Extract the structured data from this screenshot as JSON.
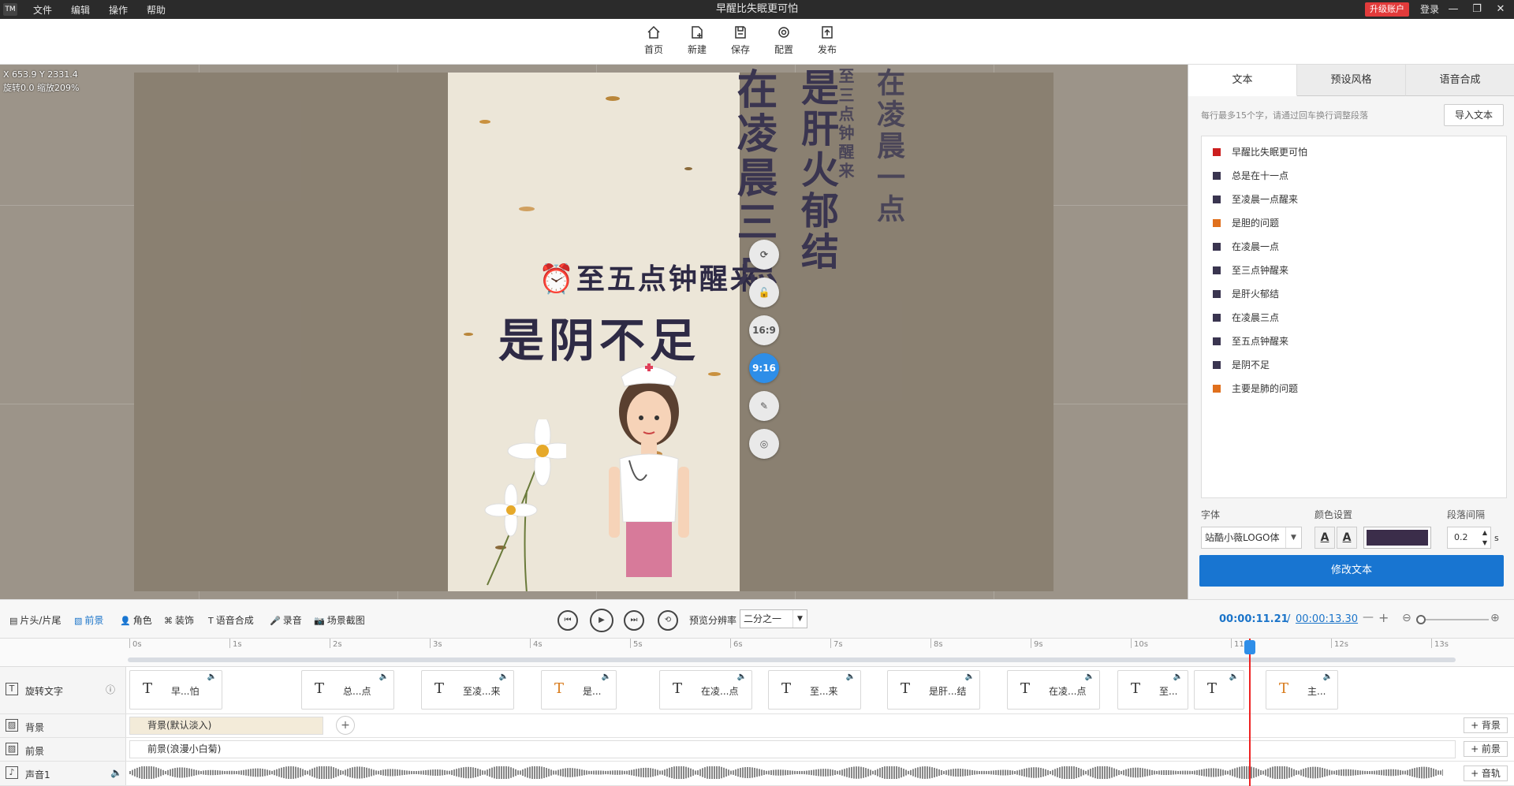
{
  "window": {
    "logo": "TM",
    "title": "早醒比失眠更可怕",
    "menu": [
      "文件",
      "编辑",
      "操作",
      "帮助"
    ],
    "upgrade_label": "升级账户",
    "login_label": "登录",
    "controls": [
      "—",
      "❐",
      "✕"
    ]
  },
  "toolbar": {
    "home": "首页",
    "new": "新建",
    "save": "保存",
    "config": "配置",
    "publish": "发布"
  },
  "canvas": {
    "coord_line": "X 653.9 Y 2331.4",
    "transform_line": "旋转0.0 缩放209%",
    "preview_line1": "⏰至五点钟醒来",
    "preview_line2": "是阴不足",
    "vertical_texts": [
      "在凌晨一点",
      "至三点钟醒来",
      "是肝火郁结",
      "在凌晨三点"
    ],
    "side_buttons": {
      "ratio_16_9": "16:9",
      "ratio_9_16": "9:16"
    }
  },
  "right_panel": {
    "tabs": [
      "文本",
      "预设风格",
      "语音合成"
    ],
    "hint": "每行最多15个字，请通过回车换行调整段落",
    "import_label": "导入文本",
    "lines": [
      {
        "text": "早醒比失眠更可怕",
        "color": "#cc1f1f"
      },
      {
        "text": "总是在十一点",
        "color": "#3a3550"
      },
      {
        "text": "至凌晨一点醒来",
        "color": "#3a3550"
      },
      {
        "text": "是胆的问题",
        "color": "#e0701d"
      },
      {
        "text": "在凌晨一点",
        "color": "#3a3550"
      },
      {
        "text": "至三点钟醒来",
        "color": "#3a3550"
      },
      {
        "text": "是肝火郁结",
        "color": "#3a3550"
      },
      {
        "text": "在凌晨三点",
        "color": "#3a3550"
      },
      {
        "text": "至五点钟醒来",
        "color": "#3a3550"
      },
      {
        "text": "是阴不足",
        "color": "#3a3550"
      },
      {
        "text": "主要是肺的问题",
        "color": "#e0701d"
      }
    ],
    "font_label": "字体",
    "font_value": "站酷小薇LOGO体",
    "color_label": "颜色设置",
    "color_swatch": "#3b2d4a",
    "spacing_label": "段落间隔",
    "spacing_value": "0.2",
    "spacing_unit": "s",
    "edit_label": "修改文本"
  },
  "controls": {
    "tabs": [
      "片头/片尾",
      "前景",
      "角色",
      "装饰",
      "语音合成",
      "录音",
      "场景截图"
    ],
    "resolution_label": "预览分辨率",
    "resolution_value": "二分之一",
    "time_current": "00:00:11.21",
    "time_sep": "/",
    "time_total": "00:00:13.30",
    "zoom_minus": "—",
    "zoom_plus": "+"
  },
  "timeline": {
    "ticks": [
      "0s",
      "1s",
      "2s",
      "3s",
      "4s",
      "5s",
      "6s",
      "7s",
      "8s",
      "9s",
      "10s",
      "11s",
      "12s",
      "13s"
    ],
    "tracks": {
      "rotate_text": "旋转文字",
      "background": "背景",
      "foreground": "前景",
      "audio": "声音1"
    },
    "text_clips": [
      {
        "label": "早...怕",
        "orange": false
      },
      {
        "label": "总...点",
        "orange": false
      },
      {
        "label": "至凌...来",
        "orange": false
      },
      {
        "label": "是...",
        "orange": true
      },
      {
        "label": "在凌...点",
        "orange": false
      },
      {
        "label": "至...来",
        "orange": false
      },
      {
        "label": "是肝...结",
        "orange": false
      },
      {
        "label": "在凌...点",
        "orange": false
      },
      {
        "label": "至...",
        "orange": false
      },
      {
        "label": "",
        "orange": false
      },
      {
        "label": "主...",
        "orange": true
      }
    ],
    "bg_clip": "背景(默认淡入)",
    "fg_clip": "前景(浪漫小白菊)",
    "add_bg": "+ 背景",
    "add_fg": "+ 前景",
    "add_audio": "+ 音轨"
  }
}
